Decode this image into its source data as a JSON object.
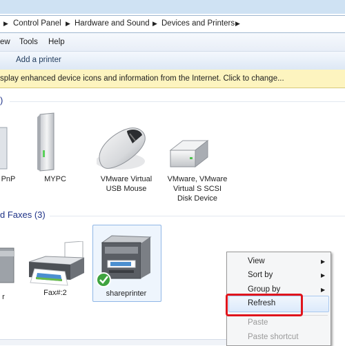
{
  "breadcrumb": {
    "items": [
      "Control Panel",
      "Hardware and Sound",
      "Devices and Printers"
    ]
  },
  "menubar": {
    "items": [
      "ew",
      "Tools",
      "Help"
    ]
  },
  "commandbar": {
    "add_printer": "Add a printer"
  },
  "infobar": {
    "text": "splay enhanced device icons and information from the Internet. Click to change..."
  },
  "groups": {
    "devices": {
      "header": ")"
    },
    "printers": {
      "header": "d Faxes (3)"
    }
  },
  "devices": [
    {
      "label_lines": [
        "PnP"
      ],
      "icon": "generic-device-icon"
    },
    {
      "label_lines": [
        "MYPC"
      ],
      "icon": "computer-tower-icon"
    },
    {
      "label_lines": [
        "VMware Virtual",
        "USB Mouse"
      ],
      "icon": "mouse-icon"
    },
    {
      "label_lines": [
        "VMware, VMware",
        "Virtual S SCSI",
        "Disk Device"
      ],
      "icon": "hard-disk-icon"
    }
  ],
  "printers": [
    {
      "label_lines": [
        "r"
      ],
      "icon": "printer-icon"
    },
    {
      "label_lines": [
        "Fax#:2"
      ],
      "icon": "fax-printer-icon"
    },
    {
      "label_lines": [
        "shareprinter"
      ],
      "icon": "multifunction-printer-icon",
      "selected": true,
      "default": true
    }
  ],
  "context_menu": {
    "items": [
      {
        "label": "View",
        "submenu": true,
        "enabled": true
      },
      {
        "label": "Sort by",
        "submenu": true,
        "enabled": true
      },
      {
        "label": "Group by",
        "submenu": true,
        "enabled": true
      },
      {
        "label": "Refresh",
        "submenu": false,
        "enabled": true,
        "highlighted": true
      },
      {
        "label": "Paste",
        "submenu": false,
        "enabled": false
      },
      {
        "label": "Paste shortcut",
        "submenu": false,
        "enabled": false
      }
    ]
  },
  "colors": {
    "group_header": "#1e3287",
    "highlight_box": "#e0141c",
    "infobar_bg": "#fdf4bf",
    "disabled_text": "#9a9a9a"
  }
}
